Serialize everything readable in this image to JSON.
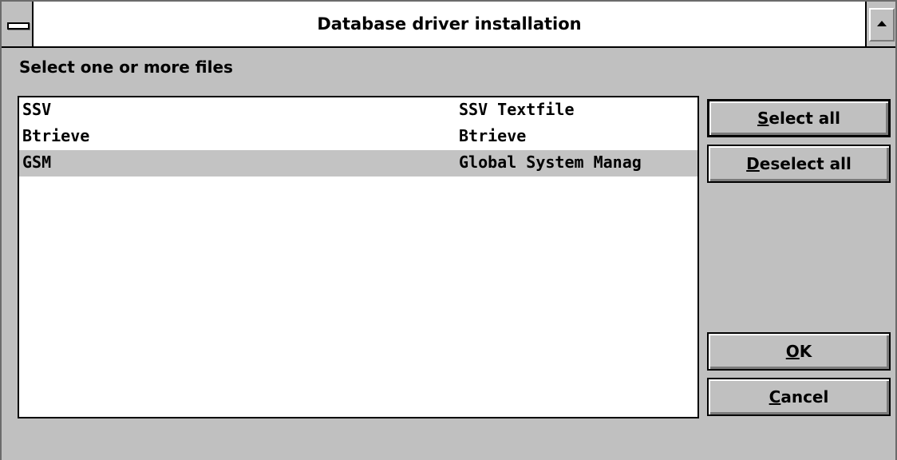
{
  "window": {
    "title": "Database driver installation"
  },
  "prompt": "Select one or more files",
  "files": [
    {
      "name": "SSV",
      "description": "SSV Textfile",
      "selected": false
    },
    {
      "name": "Btrieve",
      "description": "Btrieve",
      "selected": false
    },
    {
      "name": "GSM",
      "description": "Global System Manag",
      "selected": true
    }
  ],
  "buttons": {
    "select_all": {
      "mnemonic": "S",
      "rest": "elect all"
    },
    "deselect_all": {
      "mnemonic": "D",
      "rest": "eselect all"
    },
    "ok": {
      "mnemonic": "O",
      "rest": "K"
    },
    "cancel": {
      "mnemonic": "C",
      "rest": "ancel"
    }
  },
  "icons": {
    "system_menu": "system-menu-icon",
    "maximize": "maximize-arrow-icon"
  }
}
